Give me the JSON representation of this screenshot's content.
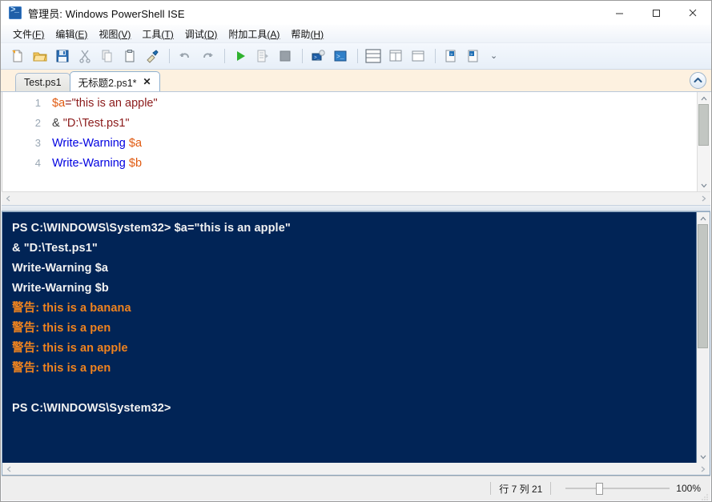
{
  "window": {
    "title": "管理员: Windows PowerShell ISE",
    "app_icon": "powershell-ise-icon",
    "minimize_label": "−",
    "maximize_label": "□",
    "close_label": "✕"
  },
  "menu": {
    "items": [
      {
        "label": "文件",
        "accel": "(F)"
      },
      {
        "label": "编辑",
        "accel": "(E)"
      },
      {
        "label": "视图",
        "accel": "(V)"
      },
      {
        "label": "工具",
        "accel": "(T)"
      },
      {
        "label": "调试",
        "accel": "(D)"
      },
      {
        "label": "附加工具",
        "accel": "(A)"
      },
      {
        "label": "帮助",
        "accel": "(H)"
      }
    ]
  },
  "toolbar": {
    "overflow_label": "⌄",
    "buttons": [
      {
        "name": "new-script-icon"
      },
      {
        "name": "open-folder-icon"
      },
      {
        "name": "save-icon"
      },
      {
        "name": "cut-scissors-icon"
      },
      {
        "name": "copy-icon"
      },
      {
        "name": "paste-clipboard-icon"
      },
      {
        "name": "clear-console-icon"
      },
      {
        "name": "undo-icon"
      },
      {
        "name": "redo-icon"
      },
      {
        "name": "run-script-icon"
      },
      {
        "name": "run-selection-icon"
      },
      {
        "name": "stop-operation-icon"
      },
      {
        "name": "new-remote-session-icon"
      },
      {
        "name": "start-powershell-icon"
      },
      {
        "name": "layout-horizontal-icon"
      },
      {
        "name": "layout-vertical-icon"
      },
      {
        "name": "layout-maximize-script-icon"
      },
      {
        "name": "show-script-pane-top-icon"
      },
      {
        "name": "show-script-pane-right-icon"
      }
    ]
  },
  "tabs": [
    {
      "label": "Test.ps1",
      "active": false,
      "closable": false
    },
    {
      "label": "无标题2.ps1*",
      "active": true,
      "closable": true,
      "close_label": "✕"
    }
  ],
  "editor": {
    "collapse_button_label": "⌃",
    "lines": [
      {
        "number": "1",
        "tokens": [
          {
            "text": "$a",
            "type": "var"
          },
          {
            "text": "=\"this is an apple\"",
            "type": "string"
          }
        ]
      },
      {
        "number": "2",
        "tokens": [
          {
            "text": "& ",
            "type": "op"
          },
          {
            "text": "\"D:\\Test.ps1\"",
            "type": "string"
          }
        ]
      },
      {
        "number": "3",
        "tokens": [
          {
            "text": "Write-Warning ",
            "type": "cmd"
          },
          {
            "text": "$a",
            "type": "var"
          }
        ]
      },
      {
        "number": "4",
        "tokens": [
          {
            "text": "Write-Warning ",
            "type": "cmd"
          },
          {
            "text": "$b",
            "type": "var"
          }
        ]
      }
    ]
  },
  "console": {
    "background": "#012456",
    "text_color": "#f2f2f2",
    "warning_color": "#f0831e",
    "lines": [
      {
        "text": "PS C:\\WINDOWS\\System32> $a=\"this is an apple\"",
        "kind": "normal"
      },
      {
        "text": "& \"D:\\Test.ps1\"",
        "kind": "normal"
      },
      {
        "text": "Write-Warning $a",
        "kind": "normal"
      },
      {
        "text": "Write-Warning $b",
        "kind": "normal"
      },
      {
        "text": "警告: this is a banana",
        "kind": "warning"
      },
      {
        "text": "警告: this is a pen",
        "kind": "warning"
      },
      {
        "text": "警告: this is an apple",
        "kind": "warning"
      },
      {
        "text": "警告: this is a pen",
        "kind": "warning"
      },
      {
        "text": " ",
        "kind": "blank"
      },
      {
        "text": "PS C:\\WINDOWS\\System32>",
        "kind": "normal"
      }
    ]
  },
  "statusbar": {
    "position_text": "行 7  列 21",
    "zoom_percent": "100%"
  }
}
